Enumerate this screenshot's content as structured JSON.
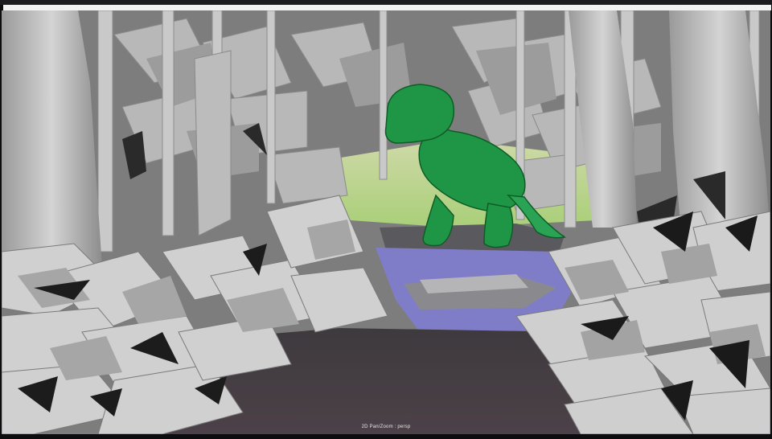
{
  "viewport": {
    "camera_label": "2D Pan/Zoom : persp"
  }
}
